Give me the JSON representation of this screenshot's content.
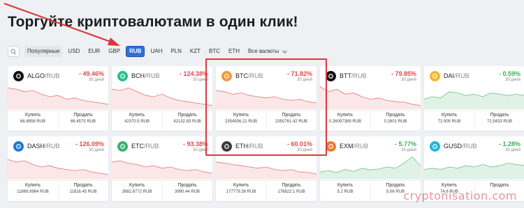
{
  "title": "Торгуйте криптовалютами в один клик!",
  "filters": {
    "items": [
      "Популярные",
      "USD",
      "EUR",
      "GBP",
      "RUB",
      "UAH",
      "PLN",
      "KZT",
      "BTC",
      "ETH"
    ],
    "active": "RUB",
    "all_label": "Все валюты"
  },
  "cards": [
    {
      "coin": "ALGO",
      "quote": "/RUB",
      "change": "- 49.46%",
      "direction": "down",
      "period": "30 дней",
      "buy_label": "Купить",
      "buy_price": "66.8856 RUB",
      "sell_label": "Продать",
      "sell_price": "66.4575 RUB",
      "icon": "algo-icon",
      "icon_color": "#111111"
    },
    {
      "coin": "BCH",
      "quote": "/RUB",
      "change": "- 124.38%",
      "direction": "down",
      "period": "30 дней",
      "buy_label": "Купить",
      "buy_price": "42370.5 RUB",
      "sell_label": "Продать",
      "sell_price": "42132.83 RUB",
      "icon": "bch-icon",
      "icon_color": "#2bbf8a"
    },
    {
      "coin": "BTC",
      "quote": "/RUB",
      "change": "- 71.82%",
      "direction": "down",
      "period": "30 дней",
      "buy_label": "Купить",
      "buy_price": "2354836.21 RUB",
      "sell_label": "Продать",
      "sell_price": "2350761.42 RUB",
      "icon": "btc-icon",
      "icon_color": "#f39a3b"
    },
    {
      "coin": "BTT",
      "quote": "/RUB",
      "change": "- 79.85%",
      "direction": "down",
      "period": "30 дней",
      "buy_label": "Купить",
      "buy_price": "0.26097389 RUB",
      "sell_label": "Продать",
      "sell_price": "0.2601 RUB",
      "icon": "btt-icon",
      "icon_color": "#111111"
    },
    {
      "coin": "DAI",
      "quote": "/RUB",
      "change": "- 0.59%",
      "direction": "up",
      "period": "30 дней",
      "buy_label": "Купить",
      "buy_price": "72.905 RUB",
      "sell_label": "Продать",
      "sell_price": "72.5433 RUB",
      "icon": "dai-icon",
      "icon_color": "#f5b730"
    },
    {
      "coin": "DASH",
      "quote": "/RUB",
      "change": "- 126.09%",
      "direction": "down",
      "period": "30 дней",
      "buy_label": "Купить",
      "buy_price": "11869.9964 RUB",
      "sell_label": "Продать",
      "sell_price": "11816.45 RUB",
      "icon": "dash-icon",
      "icon_color": "#1d78d6"
    },
    {
      "coin": "ETC",
      "quote": "/RUB",
      "change": "- 93.38%",
      "direction": "down",
      "period": "30 дней",
      "buy_label": "Купить",
      "buy_price": "3982.6772 RUB",
      "sell_label": "Продать",
      "sell_price": "3990.44 RUB",
      "icon": "etc-icon",
      "icon_color": "#3ab16d"
    },
    {
      "coin": "ETH",
      "quote": "/RUB",
      "change": "- 60.01%",
      "direction": "down",
      "period": "30 дней",
      "buy_label": "Купить",
      "buy_price": "177779.39 RUB",
      "sell_label": "Продать",
      "sell_price": "176822.1 RUB",
      "icon": "eth-icon",
      "icon_color": "#3c3c3d"
    },
    {
      "coin": "EXM",
      "quote": "/RUB",
      "change": "- 5.77%",
      "direction": "up",
      "period": "30 дней",
      "buy_label": "Купить",
      "buy_price": "5.2 RUB",
      "sell_label": "Продать",
      "sell_price": "5.06 RUB",
      "icon": "exm-icon",
      "icon_color": "#f07a2a"
    },
    {
      "coin": "GUSD",
      "quote": "/RUB",
      "change": "- 1.28%",
      "direction": "up",
      "period": "30 дней",
      "buy_label": "Купить",
      "buy_price": "74.6 RUB",
      "sell_label": "Продать",
      "sell_price": "",
      "icon": "gusd-icon",
      "icon_color": "#1fb7d9"
    }
  ],
  "watermark": "cryptonisation.com",
  "colors": {
    "down": "#e2484d",
    "up": "#3fae5b",
    "accent": "#2f6fd6",
    "highlight": "#d9383e"
  }
}
